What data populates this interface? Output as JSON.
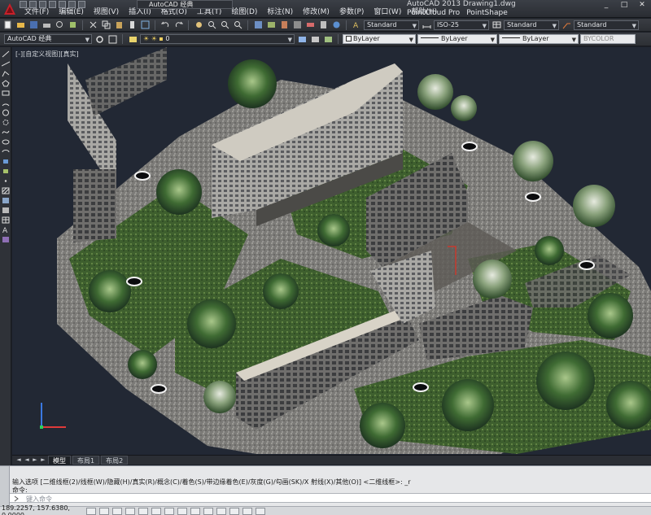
{
  "app": {
    "window_title": "AutoCAD 2013   Drawing1.dwg",
    "workspace": "AutoCAD 经典"
  },
  "menu": [
    "文件(F)",
    "编辑(E)",
    "视图(V)",
    "插入(I)",
    "格式(O)",
    "工具(T)",
    "绘图(D)",
    "标注(N)",
    "修改(M)",
    "参数(P)",
    "窗口(W)",
    "帮助(H)"
  ],
  "plugin_menu": [
    "PointCloud Pro",
    "PointShape"
  ],
  "toolbar": {
    "text_style": "Standard",
    "dim_style": "ISO-25",
    "table_style": "Standard",
    "multileader_style": "Standard",
    "workspace_combo": "AutoCAD 经典",
    "layer": "0",
    "color": "ByLayer",
    "linetype": "ByLayer",
    "lineweight": "ByLayer",
    "plotstyle": "BYCOLOR"
  },
  "viewport": {
    "label": "[-][自定义视图][真实]"
  },
  "layout_tabs": {
    "items": [
      "模型",
      "布局1",
      "布局2"
    ],
    "active": 0
  },
  "command": {
    "line1": "输入选项 [二维线框(2)/线框(W)/隐藏(H)/真实(R)/概念(C)/着色(S)/带边缘着色(E)/灰度(G)/勾画(SK)/X 射线(X)/其他(O)] <二维线框>: _r",
    "line2": "命令:",
    "placeholder": "键入命令"
  },
  "status": {
    "coordinates": "189.2257, 157.6380, 0.0000"
  },
  "colors": {
    "viewport_bg": "#222834",
    "chrome_dark": "#2d3035",
    "command_bg": "#e6e7e9"
  }
}
